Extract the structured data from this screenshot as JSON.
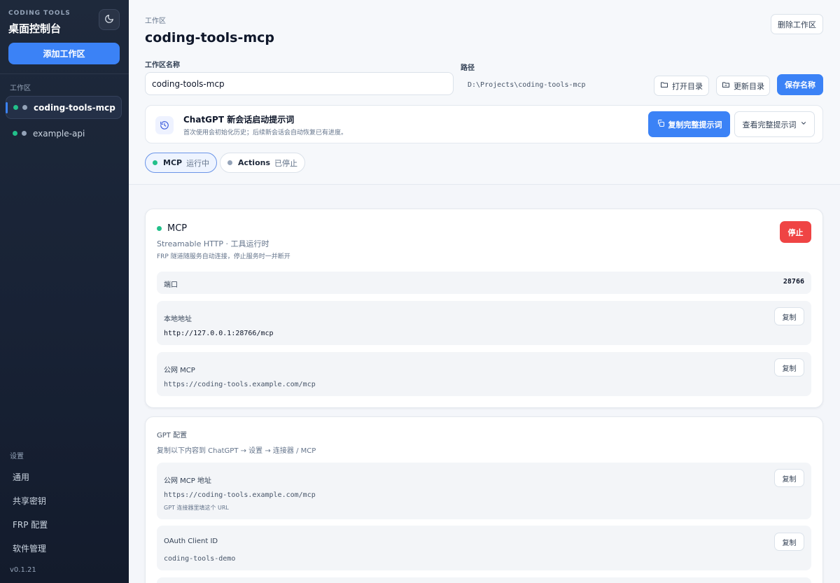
{
  "sidebar": {
    "brand_top": "CODING TOOLS",
    "brand_title": "桌面控制台",
    "add_workspace": "添加工作区",
    "workspaces_heading": "工作区",
    "workspaces": [
      {
        "name": "coding-tools-mcp",
        "active": true
      },
      {
        "name": "example-api",
        "active": false
      }
    ],
    "settings_heading": "设置",
    "settings_items": [
      "通用",
      "共享密钥",
      "FRP 配置",
      "软件管理"
    ],
    "version": "v0.1.21"
  },
  "header": {
    "eyebrow": "工作区",
    "title": "coding-tools-mcp",
    "delete_button": "删除工作区",
    "name_label": "工作区名称",
    "name_value": "coding-tools-mcp",
    "path_label": "路径",
    "path_value": "D:\\Projects\\coding-tools-mcp",
    "open_dir": "打开目录",
    "update_dir": "更新目录",
    "save_name": "保存名称"
  },
  "prompt": {
    "title": "ChatGPT 新会话启动提示词",
    "subtitle": "首次使用会初始化历史；后续新会话会自动恢复已有进度。",
    "copy_button": "复制完整提示词",
    "view_button": "查看完整提示词"
  },
  "service_pills": [
    {
      "label": "MCP",
      "status": "运行中",
      "active": true
    },
    {
      "label": "Actions",
      "status": "已停止",
      "active": false
    }
  ],
  "mcp_card": {
    "title": "MCP",
    "subtitle": "Streamable HTTP · 工具运行时",
    "note": "FRP 隧道随服务自动连接，停止服务时一并断开",
    "stop_button": "停止",
    "port_label": "端口",
    "port_value": "28766",
    "local_label": "本地地址",
    "local_value": "http://127.0.0.1:28766/mcp",
    "public_label": "公网 MCP",
    "public_value": "https://coding-tools.example.com/mcp",
    "copy": "复制"
  },
  "gpt_card": {
    "title": "GPT 配置",
    "subtitle": "复制以下内容到 ChatGPT → 设置 → 连接器 / MCP",
    "url_label": "公网 MCP 地址",
    "url_value": "https://coding-tools.example.com/mcp",
    "url_note": "GPT 连接器里填这个 URL",
    "client_label": "OAuth Client ID",
    "client_value": "coding-tools-demo",
    "copy": "复制"
  },
  "colors": {
    "accent": "#3b82f6",
    "running": "#22c08a",
    "stopped": "#94a3b8",
    "danger": "#ef4444",
    "sidebar_bg": "#1e293b"
  }
}
